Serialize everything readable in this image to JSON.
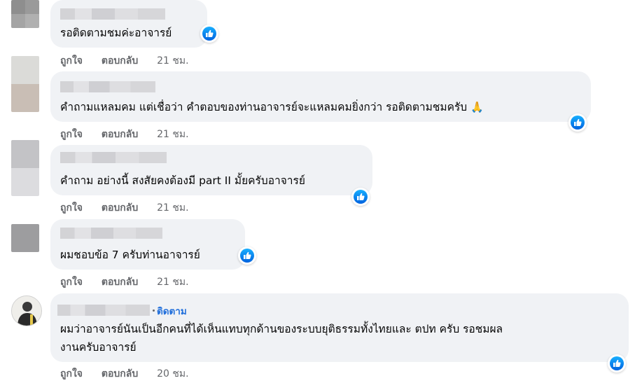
{
  "comments": [
    {
      "text": "รอติดตามชมค่ะอาจารย์",
      "like_label": "ถูกใจ",
      "reply_label": "ตอบกลับ",
      "time": "21 ชม."
    },
    {
      "text": "คำถามแหลมคม แต่เชื่อว่า คำตอบของท่านอาจารย์จะแหลมคมยิ่งกว่า รอติดตามชมครับ",
      "emoji": "🙏",
      "like_label": "ถูกใจ",
      "reply_label": "ตอบกลับ",
      "time": "21 ชม."
    },
    {
      "text": "คำถาม อย่างนี้ สงสัยคงต้องมี part II มั้ยครับอาจารย์",
      "like_label": "ถูกใจ",
      "reply_label": "ตอบกลับ",
      "time": "21 ชม."
    },
    {
      "text": "ผมชอบข้อ 7 ครับท่านอาจารย์",
      "like_label": "ถูกใจ",
      "reply_label": "ตอบกลับ",
      "time": "21 ชม."
    },
    {
      "follow_label": "ติดตาม",
      "text_line1": "ผมว่าอาจารย์นันเป็นอีกคนที่ได้เห็นแทบทุกด้านของระบบยุติธรรมทั้งไทยและ ตปท ครับ รอชมผล",
      "text_line2": "งานครับอาจารย์",
      "like_label": "ถูกใจ",
      "reply_label": "ตอบกลับ",
      "time": "20 ชม."
    }
  ],
  "icons": {
    "like": "thumbs-up-icon",
    "avatar": "avatar"
  },
  "colors": {
    "bubble": "#f0f2f5",
    "link": "#216fdb",
    "muted": "#65676b",
    "like_blue": "#0866ff"
  }
}
